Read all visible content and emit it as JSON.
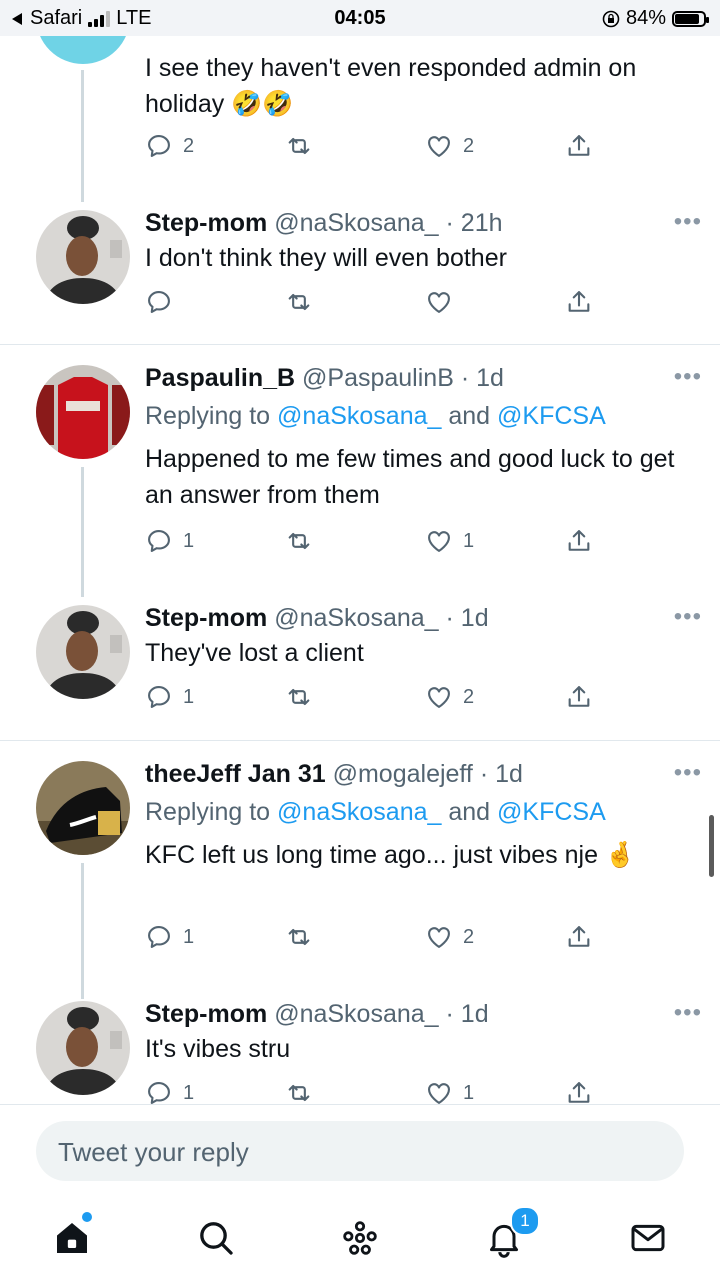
{
  "status_bar": {
    "back_app": "Safari",
    "network": "LTE",
    "time": "04:05",
    "battery": "84%",
    "battery_level": 0.84
  },
  "tweets": [
    {
      "text": "I see they haven't even responded admin on holiday 🤣🤣",
      "reply_count": "2",
      "like_count": "2"
    },
    {
      "name": "Step-mom",
      "handle": "@naSkosana_",
      "time": "· 21h",
      "text": "I don't think they will even bother",
      "reply_count": "",
      "like_count": ""
    },
    {
      "name": "Paspaulin_B",
      "handle": "@PaspaulinB",
      "time": "· 1d",
      "replying_prefix": "Replying to ",
      "mention1": "@naSkosana_",
      "conj": " and ",
      "mention2": "@KFCSA",
      "text": "Happened to me few times and good luck to get an answer from them",
      "reply_count": "1",
      "like_count": "1"
    },
    {
      "name": "Step-mom",
      "handle": "@naSkosana_",
      "time": "· 1d",
      "text": "They've lost a client",
      "reply_count": "1",
      "like_count": "2"
    },
    {
      "name": "theeJeff Jan 31",
      "handle": "@mogalejeff",
      "time": "· 1d",
      "replying_prefix": "Replying to ",
      "mention1": "@naSkosana_",
      "conj": " and ",
      "mention2": "@KFCSA",
      "text": "KFC left us long time ago... just vibes nje 🤞",
      "reply_count": "1",
      "like_count": "2"
    },
    {
      "name": "Step-mom",
      "handle": "@naSkosana_",
      "time": "· 1d",
      "text": "It's vibes stru",
      "reply_count": "1",
      "like_count": "1"
    }
  ],
  "more_label": "•••",
  "compose": {
    "placeholder": "Tweet your reply"
  },
  "tabbar": {
    "notification_count": "1"
  },
  "colors": {
    "accent": "#1d9bf0",
    "muted": "#536471",
    "divider": "#e1e8ed"
  }
}
